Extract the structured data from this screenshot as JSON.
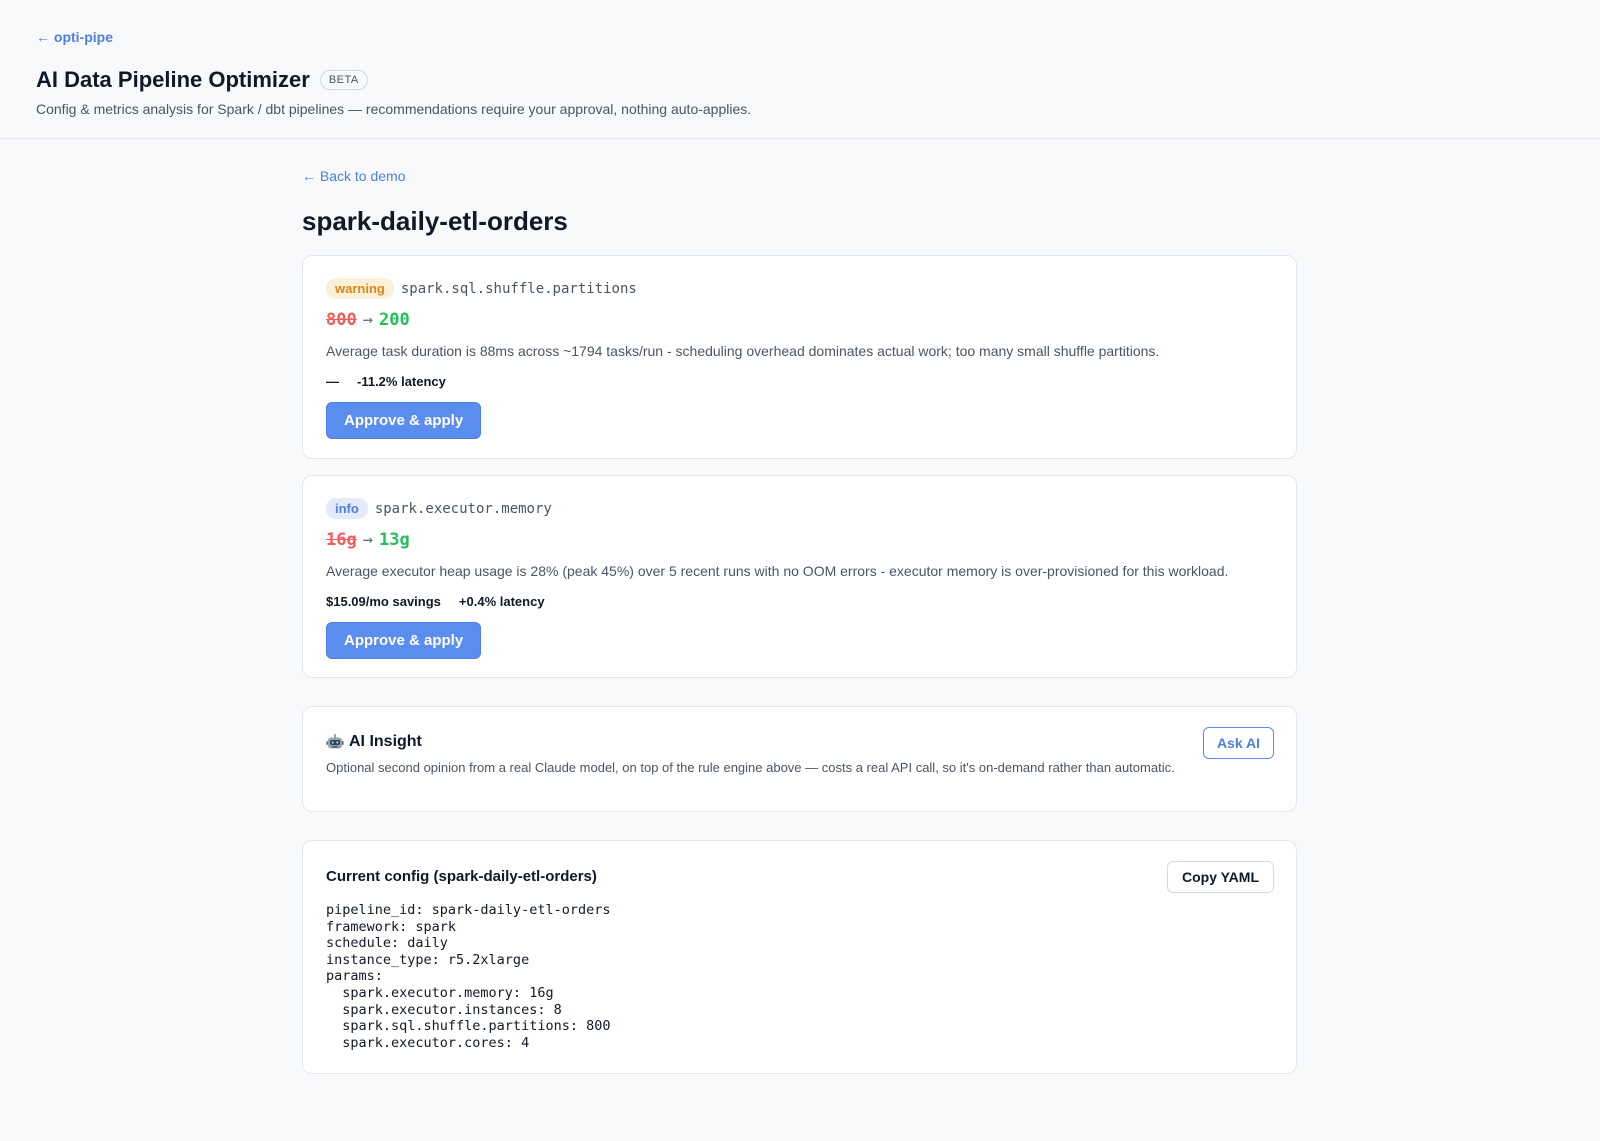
{
  "header": {
    "crumb": "← opti-pipe",
    "title": "AI Data Pipeline Optimizer",
    "badge": "BETA",
    "subtitle": "Config & metrics analysis for Spark / dbt pipelines — recommendations require your approval, nothing auto-applies."
  },
  "main": {
    "back_link": "← Back to demo",
    "pipeline_title": "spark-daily-etl-orders"
  },
  "recommendations": [
    {
      "severity": "warning",
      "param": "spark.sql.shuffle.partitions",
      "old": "800",
      "arrow": "→",
      "new": "200",
      "reason": "Average task duration is 88ms across ~1794 tasks/run - scheduling overhead dominates actual work; too many small shuffle partitions.",
      "impact_cost": "—",
      "impact_latency": "-11.2% latency",
      "button": "Approve & apply"
    },
    {
      "severity": "info",
      "param": "spark.executor.memory",
      "old": "16g",
      "arrow": "→",
      "new": "13g",
      "reason": "Average executor heap usage is 28% (peak 45%) over 5 recent runs with no OOM errors - executor memory is over-provisioned for this workload.",
      "impact_cost": "$15.09/mo savings",
      "impact_latency": "+0.4% latency",
      "button": "Approve & apply"
    }
  ],
  "insight": {
    "title": "AI Insight",
    "icon": "robot-icon",
    "description": "Optional second opinion from a real Claude model, on top of the rule engine above — costs a real API call, so it's on-demand rather than automatic.",
    "button": "Ask AI"
  },
  "config": {
    "title": "Current config (spark-daily-etl-orders)",
    "button": "Copy YAML",
    "yaml": "pipeline_id: spark-daily-etl-orders\nframework: spark\nschedule: daily\ninstance_type: r5.2xlarge\nparams:\n  spark.executor.memory: 16g\n  spark.executor.instances: 8\n  spark.sql.shuffle.partitions: 800\n  spark.executor.cores: 4"
  },
  "colors": {
    "accent": "#5b8def",
    "warning": "#d8891a",
    "old_value": "#f25b5b",
    "new_value": "#23c05a"
  }
}
